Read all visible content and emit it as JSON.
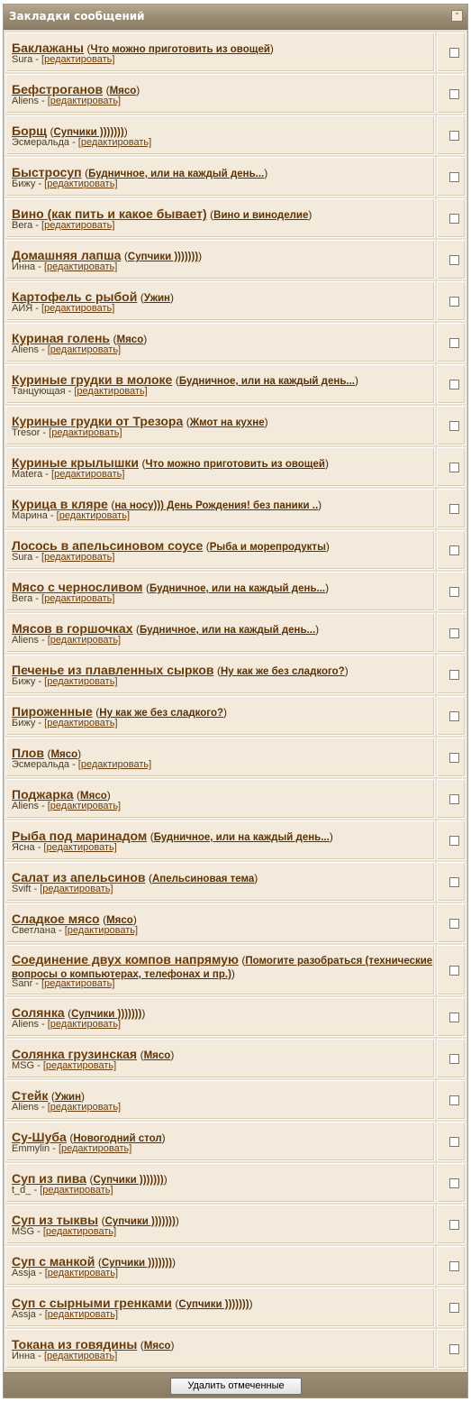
{
  "header": {
    "title": "Закладки сообщений",
    "collapse_glyph": "⌃"
  },
  "separator_dash": " - ",
  "open_paren": "(",
  "close_paren": ")",
  "edit_label": "[редактировать]",
  "bookmarks": [
    {
      "title": "Баклажаны",
      "forum": "Что можно приготовить из овощей",
      "author": "Sura"
    },
    {
      "title": "Бефстроганов",
      "forum": "Мясо",
      "author": "Aliens"
    },
    {
      "title": "Борщ",
      "forum": "Супчики )))))))",
      "author": "Эсмеральда"
    },
    {
      "title": "Быстросуп",
      "forum": "Будничное, или на каждый день...",
      "author": "Бижу"
    },
    {
      "title": "Вино (как пить и какое бывает)",
      "forum": "Вино и виноделие",
      "author": "Bera"
    },
    {
      "title": "Домашняя лапша",
      "forum": "Супчики )))))))",
      "author": "Инна"
    },
    {
      "title": "Картофель с рыбой",
      "forum": "Ужин",
      "author": "АЙЯ"
    },
    {
      "title": "Куриная голень",
      "forum": "Мясо",
      "author": "Aliens"
    },
    {
      "title": "Куриные грудки в молоке",
      "forum": "Будничное, или на каждый день...",
      "author": "Танцующая"
    },
    {
      "title": "Куриные грудки от Трезора",
      "forum": "Жмот на кухне",
      "author": "Tresor"
    },
    {
      "title": "Куриные крылышки",
      "forum": "Что можно приготовить из овощей",
      "author": "Matera"
    },
    {
      "title": "Курица в кляре",
      "forum": "на носу))) День Рождения! без паники ..",
      "author": "Марина"
    },
    {
      "title": "Лосось в апельсиновом соусе",
      "forum": "Рыба и морепродукты",
      "author": "Sura"
    },
    {
      "title": "Мясо с черносливом",
      "forum": "Будничное, или на каждый день...",
      "author": "Bera"
    },
    {
      "title": "Мясов в горшочках",
      "forum": "Будничное, или на каждый день...",
      "author": "Aliens"
    },
    {
      "title": "Печенье из плавленных сырков",
      "forum": "Ну как же без сладкого?",
      "author": "Бижу"
    },
    {
      "title": "Пироженные",
      "forum": "Ну как же без сладкого?",
      "author": "Бижу"
    },
    {
      "title": "Плов",
      "forum": "Мясо",
      "author": "Эсмеральда"
    },
    {
      "title": "Поджарка",
      "forum": "Мясо",
      "author": "Aliens"
    },
    {
      "title": "Рыба под маринадом",
      "forum": "Будничное, или на каждый день...",
      "author": "Ясна"
    },
    {
      "title": "Салат из апельсинов",
      "forum": "Апельсиновая тема",
      "author": "Svift"
    },
    {
      "title": "Сладкое мясо",
      "forum": "Мясо",
      "author": "Светлана"
    },
    {
      "title": "Соединение двух компов напрямую",
      "forum": "Помогите разобраться (технические вопросы о компьютерах, телефонах и пр.)",
      "author": "Sanr",
      "tall": true
    },
    {
      "title": "Солянка",
      "forum": "Супчики )))))))",
      "author": "Aliens"
    },
    {
      "title": "Солянка грузинская",
      "forum": "Мясо",
      "author": "MSG"
    },
    {
      "title": "Стейк",
      "forum": "Ужин",
      "author": "Aliens"
    },
    {
      "title": "Су-Шуба",
      "forum": "Новогодний стол",
      "author": "Emmylin"
    },
    {
      "title": "Суп из пива",
      "forum": "Супчики )))))))",
      "author": "t_d_"
    },
    {
      "title": "Суп из тыквы",
      "forum": "Супчики )))))))",
      "author": "MSG"
    },
    {
      "title": "Суп с манкой",
      "forum": "Супчики )))))))",
      "author": "Assja"
    },
    {
      "title": "Суп с сырными гренками",
      "forum": "Супчики )))))))",
      "author": "Assja"
    },
    {
      "title": "Токана из говядины",
      "forum": "Мясо",
      "author": "Инна"
    }
  ],
  "footer": {
    "delete_button_label": "Удалить отмеченные"
  }
}
